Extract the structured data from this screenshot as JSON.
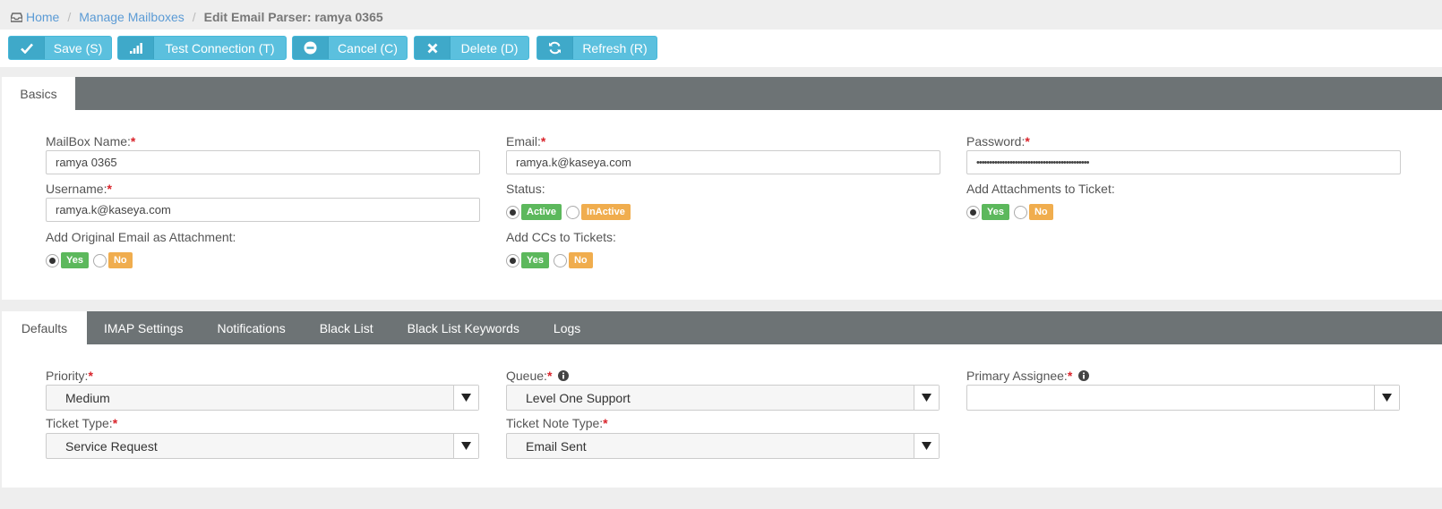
{
  "breadcrumb": {
    "home": "Home",
    "manage": "Manage Mailboxes",
    "current": "Edit Email Parser: ramya 0365"
  },
  "toolbar": {
    "save": "Save (S)",
    "test": "Test Connection (T)",
    "cancel": "Cancel (C)",
    "delete": "Delete (D)",
    "refresh": "Refresh (R)"
  },
  "basics": {
    "tab": "Basics",
    "mailbox_name": {
      "label": "MailBox Name:",
      "value": "ramya 0365"
    },
    "email": {
      "label": "Email:",
      "value": "ramya.k@kaseya.com"
    },
    "password": {
      "label": "Password:",
      "value": "••••••••••••••••••••••••••••••••••••••••••••"
    },
    "username": {
      "label": "Username:",
      "value": "ramya.k@kaseya.com"
    },
    "status": {
      "label": "Status:",
      "active": "Active",
      "inactive": "InActive"
    },
    "add_attachments": {
      "label": "Add Attachments to Ticket:",
      "yes": "Yes",
      "no": "No"
    },
    "add_original": {
      "label": "Add Original Email as Attachment:",
      "yes": "Yes",
      "no": "No"
    },
    "add_ccs": {
      "label": "Add CCs to Tickets:",
      "yes": "Yes",
      "no": "No"
    }
  },
  "required_mark": "*",
  "tabs": [
    "Defaults",
    "IMAP Settings",
    "Notifications",
    "Black List",
    "Black List Keywords",
    "Logs"
  ],
  "defaults": {
    "priority": {
      "label": "Priority:",
      "value": "Medium"
    },
    "queue": {
      "label": "Queue:",
      "value": "Level One Support"
    },
    "primary_assignee": {
      "label": "Primary Assignee:",
      "value": ""
    },
    "ticket_type": {
      "label": "Ticket Type:",
      "value": "Service Request"
    },
    "ticket_note_type": {
      "label": "Ticket Note Type:",
      "value": "Email Sent"
    }
  },
  "colors": {
    "accent": "#5bc0de",
    "tabbar": "#6d7375",
    "yes": "#5cb85c",
    "no": "#f0ad4e",
    "required": "#d9242b"
  },
  "icons": {
    "home": "inbox-icon",
    "save": "check-icon",
    "test": "signal-bars-icon",
    "cancel": "minus-circle-icon",
    "delete": "x-icon",
    "refresh": "refresh-icon"
  }
}
